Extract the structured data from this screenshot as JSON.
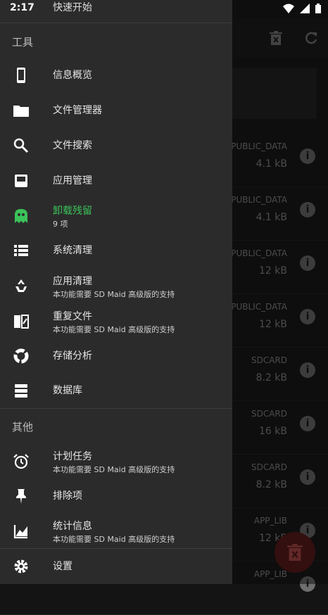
{
  "status": {
    "time": "2:17"
  },
  "drawer": {
    "top_item": "快速开始",
    "tools_header": "工具",
    "other_header": "其他",
    "items": [
      {
        "label": "信息概览"
      },
      {
        "label": "文件管理器"
      },
      {
        "label": "文件搜索"
      },
      {
        "label": "应用管理"
      },
      {
        "label": "卸载残留",
        "sub": "9 项",
        "accent": "#3bc35a"
      },
      {
        "label": "系统清理"
      },
      {
        "label": "应用清理",
        "sub": "本功能需要 SD Maid 高级版的支持"
      },
      {
        "label": "重复文件",
        "sub": "本功能需要 SD Maid 高级版的支持"
      },
      {
        "label": "存储分析"
      },
      {
        "label": "数据库"
      },
      {
        "label": "计划任务",
        "sub": "本功能需要 SD Maid 高级版的支持"
      },
      {
        "label": "排除项"
      },
      {
        "label": "统计信息",
        "sub": "本功能需要 SD Maid 高级版的支持"
      },
      {
        "label": "设置"
      }
    ]
  },
  "background": {
    "rows": [
      {
        "loc": "PUBLIC_DATA",
        "size": "4.1 kB"
      },
      {
        "loc": "PUBLIC_DATA",
        "size": "4.1 kB"
      },
      {
        "loc": "PUBLIC_DATA",
        "size": "12 kB"
      },
      {
        "loc": "PUBLIC_DATA",
        "size": "12 kB"
      },
      {
        "loc": "SDCARD",
        "size": "8.2 kB"
      },
      {
        "loc": "SDCARD",
        "size": "16 kB"
      },
      {
        "loc": "SDCARD",
        "size": "8.2 kB"
      },
      {
        "loc": "APP_LIB",
        "size": "12 kB"
      },
      {
        "loc": "APP_LIB",
        "size": ""
      }
    ]
  }
}
